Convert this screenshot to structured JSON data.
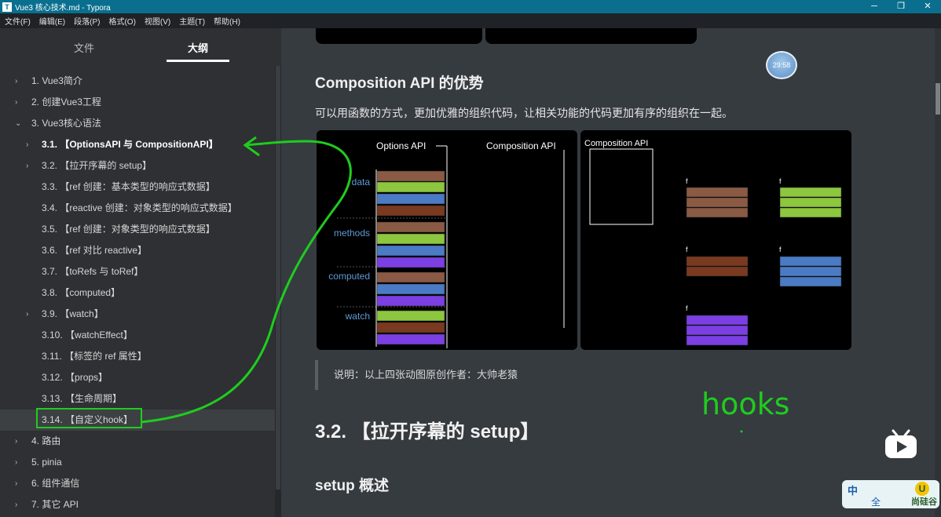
{
  "window": {
    "title": "Vue3 核心技术.md - Typora"
  },
  "menu": [
    "文件(F)",
    "编辑(E)",
    "段落(P)",
    "格式(O)",
    "视图(V)",
    "主题(T)",
    "帮助(H)"
  ],
  "sidebar": {
    "tab_file": "文件",
    "tab_outline": "大纲",
    "items": [
      {
        "label": "1. Vue3简介",
        "level": 1,
        "chevron": "›"
      },
      {
        "label": "2. 创建Vue3工程",
        "level": 1,
        "chevron": "›"
      },
      {
        "label": "3. Vue3核心语法",
        "level": 1,
        "chevron": "⌄"
      },
      {
        "label": "3.1. 【OptionsAPI 与 CompositionAPI】",
        "level": 2,
        "chevron": "›",
        "bold": true
      },
      {
        "label": "3.2. 【拉开序幕的 setup】",
        "level": 2,
        "chevron": "›"
      },
      {
        "label": "3.3. 【ref 创建：基本类型的响应式数据】",
        "level": 2
      },
      {
        "label": "3.4. 【reactive 创建：对象类型的响应式数据】",
        "level": 2
      },
      {
        "label": "3.5. 【ref 创建：对象类型的响应式数据】",
        "level": 2
      },
      {
        "label": "3.6. 【ref 对比 reactive】",
        "level": 2
      },
      {
        "label": "3.7. 【toRefs 与 toRef】",
        "level": 2
      },
      {
        "label": "3.8. 【computed】",
        "level": 2
      },
      {
        "label": "3.9. 【watch】",
        "level": 2,
        "chevron": "›"
      },
      {
        "label": "3.10. 【watchEffect】",
        "level": 2
      },
      {
        "label": "3.11. 【标签的 ref 属性】",
        "level": 2
      },
      {
        "label": "3.12. 【props】",
        "level": 2
      },
      {
        "label": "3.13. 【生命周期】",
        "level": 2
      },
      {
        "label": "3.14. 【自定义hook】",
        "level": 2,
        "active": true
      },
      {
        "label": "4. 路由",
        "level": 1,
        "chevron": "›"
      },
      {
        "label": "5. pinia",
        "level": 1,
        "chevron": "›"
      },
      {
        "label": "6. 组件通信",
        "level": 1,
        "chevron": "›"
      },
      {
        "label": "7. 其它 API",
        "level": 1,
        "chevron": "›"
      }
    ]
  },
  "content": {
    "heading_composition": "Composition API 的优势",
    "desc": "可以用函数的方式，更加优雅的组织代码，让相关功能的代码更加有序的组织在一起。",
    "clock_text": "29:58",
    "fig_left": {
      "options_title": "Options API",
      "composition_title": "Composition API",
      "labels": [
        "data",
        "methods",
        "computed",
        "watch"
      ],
      "label_color": "#5d9bd6"
    },
    "fig_right": {
      "title": "Composition API",
      "f_marks": [
        "f",
        "f",
        "f",
        "f",
        "f"
      ]
    },
    "blockquote": "说明：以上四张动图原创作者：大帅老猿",
    "heading_setup": "3.2. 【拉开序幕的 setup】",
    "heading_overview": "setup 概述"
  },
  "annotation": {
    "text": "hooks",
    "color": "#1fcc1f"
  },
  "ime": {
    "zh": "中",
    "quan": "全",
    "brand": "尚硅谷",
    "logo": "U"
  },
  "colors": {
    "brown": "#8a5a44",
    "green": "#8dc63f",
    "blue": "#4a7bc4",
    "purple": "#7b3fe4",
    "rust": "#7a3a20"
  }
}
